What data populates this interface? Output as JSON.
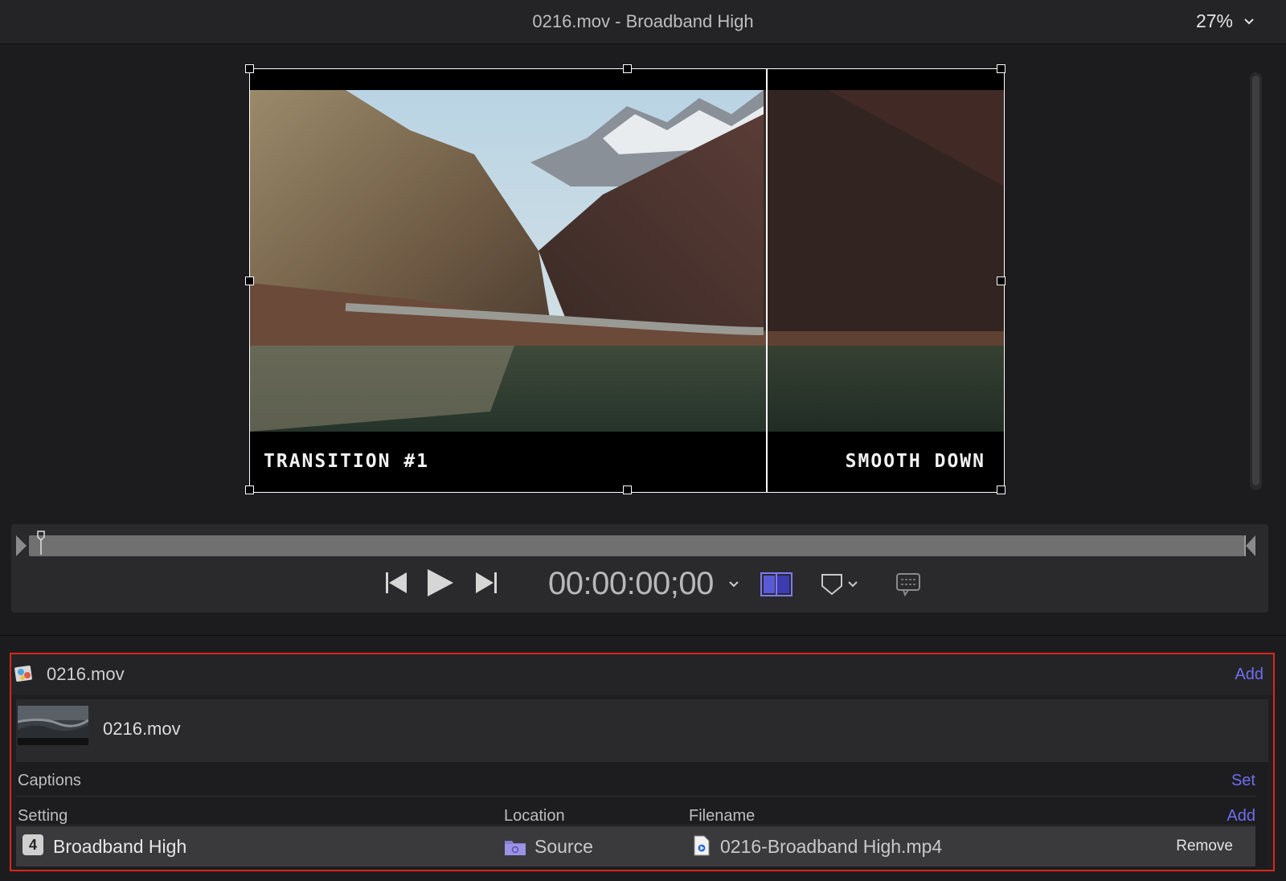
{
  "window": {
    "title": "0216.mov - Broadband High",
    "zoom": "27%"
  },
  "viewer": {
    "caption_left": "TRANSITION #1",
    "caption_right": "SMOOTH DOWN"
  },
  "transport": {
    "timecode": "00:00:00;00"
  },
  "batch": {
    "source_file": "0216.mov",
    "add_label": "Add",
    "job": {
      "name": "0216.mov",
      "captions_label": "Captions",
      "set_label": "Set",
      "columns": {
        "setting": "Setting",
        "location": "Location",
        "filename": "Filename"
      },
      "add_label": "Add",
      "output": {
        "index": "4",
        "setting": "Broadband High",
        "location": "Source",
        "filename": "0216-Broadband High.mp4",
        "remove_label": "Remove"
      }
    }
  },
  "colors": {
    "accent": "#6f6ef0",
    "highlight_border": "#d9261c"
  }
}
